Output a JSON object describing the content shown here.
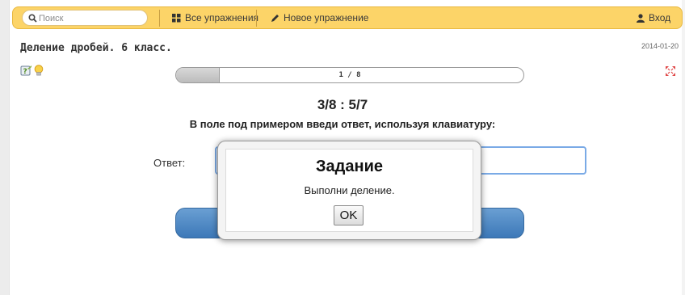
{
  "nav": {
    "search_placeholder": "Поиск",
    "all_exercises": "Все упражнения",
    "new_exercise": "Новое упражнение",
    "login": "Вход",
    "accent_color": "#fcd468"
  },
  "page": {
    "title": "Деление дробей. 6 класс.",
    "date": "2014-01-20"
  },
  "progress": {
    "label": "1 / 8",
    "current": 1,
    "total": 8
  },
  "exercise": {
    "problem": "3/8 : 5/7",
    "instruction": "В поле под примером введи ответ, используя клавиатуру:",
    "answer_label": "Ответ:",
    "answer_value": ""
  },
  "modal": {
    "title": "Задание",
    "text": "Выполни деление.",
    "ok_label": "OK"
  },
  "icons": [
    "search-icon",
    "grid-icon",
    "pencil-icon",
    "user-icon",
    "help-icon",
    "hint-bulb-icon",
    "fullscreen-icon"
  ]
}
